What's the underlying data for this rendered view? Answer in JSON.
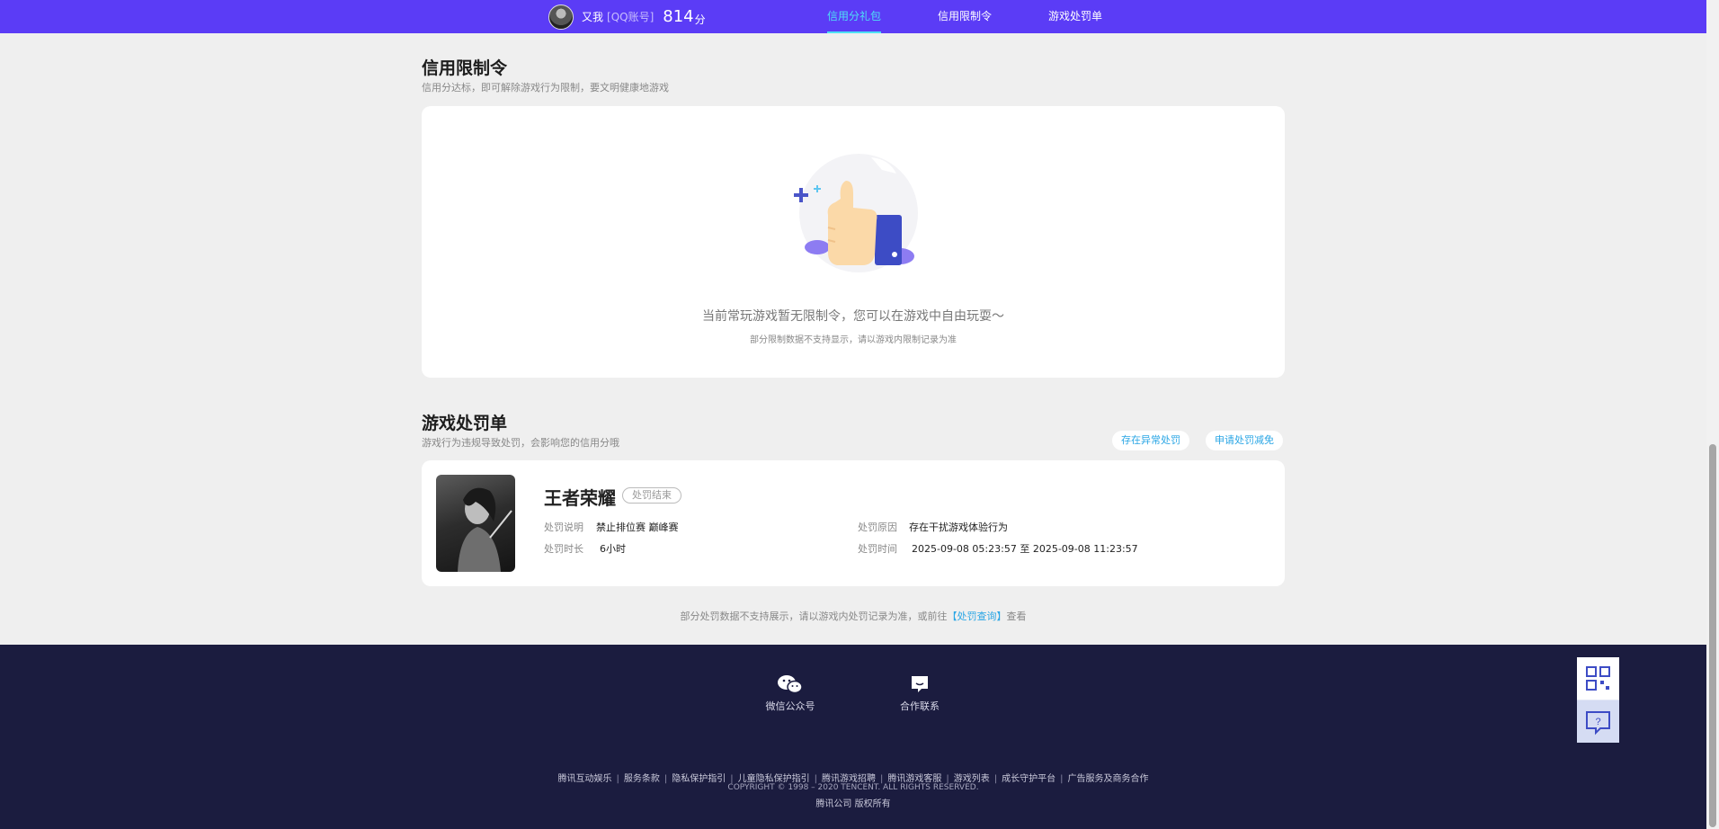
{
  "header": {
    "user_name": "又我",
    "account_type": "[QQ账号]",
    "score": "814",
    "score_unit": "分",
    "tabs": [
      {
        "label": "信用分礼包",
        "active": true
      },
      {
        "label": "信用限制令",
        "active": false
      },
      {
        "label": "游戏处罚单",
        "active": false
      }
    ]
  },
  "restriction": {
    "title": "信用限制令",
    "subtitle": "信用分达标，即可解除游戏行为限制，要文明健康地游戏",
    "empty_text": "当前常玩游戏暂无限制令，您可以在游戏中自由玩耍～",
    "empty_note": "部分限制数据不支持显示，请以游戏内限制记录为准"
  },
  "penalty": {
    "title": "游戏处罚单",
    "subtitle": "游戏行为违规导致处罚，会影响您的信用分哦",
    "appeal_button": "存在异常处罚",
    "reduce_button": "申请处罚减免",
    "item": {
      "game": "王者荣耀",
      "status": "处罚结束",
      "desc_label": "处罚说明",
      "desc_value": "禁止排位赛 巅峰赛",
      "duration_label": "处罚时长",
      "duration_value": "6小时",
      "reason_label": "处罚原因",
      "reason_value": "存在干扰游戏体验行为",
      "time_label": "处罚时间",
      "time_start": "2025-09-08 05:23:57",
      "time_sep": "至",
      "time_end": "2025-09-08 11:23:57"
    },
    "footnote_before": "部分处罚数据不支持展示，请以游戏内处罚记录为准，或前往",
    "footnote_link": "【处罚查询】",
    "footnote_after": "查看"
  },
  "footer": {
    "wechat_label": "微信公众号",
    "contact_label": "合作联系",
    "links": [
      "腾讯互动娱乐",
      "服务条款",
      "隐私保护指引",
      "儿童隐私保护指引",
      "腾讯游戏招聘",
      "腾讯游戏客服",
      "游戏列表",
      "成长守护平台",
      "广告服务及商务合作"
    ],
    "link_sep": "|",
    "copyright": "COPYRIGHT © 1998 – 2020 TENCENT. ALL RIGHTS RESERVED.",
    "company": "腾讯公司 版权所有"
  },
  "colors": {
    "header_bg": "#5b3cf6",
    "active_tab": "#4ee0f5",
    "link": "#2aa6e5",
    "footer_bg": "#1b1c3f"
  },
  "icons": {
    "qr_code": "qrcode-icon",
    "help": "help-chat-icon",
    "wechat": "wechat-icon",
    "contact": "chat-bubble-icon"
  }
}
